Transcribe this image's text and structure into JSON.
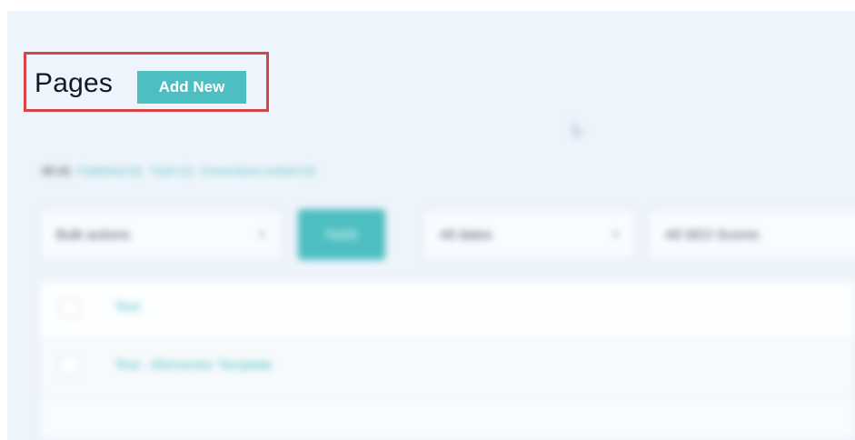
{
  "page": {
    "title": "Pages",
    "add_new_label": "Add New"
  },
  "filters": {
    "bulk_actions": "Bulk actions",
    "apply_label": "Apply",
    "dates": "All dates",
    "seo_scores": "All SEO Scores"
  },
  "views": {
    "all": "All (4)",
    "published": "Published (4)",
    "trash": "Trash (2)",
    "cornerstone": "Cornerstone content (0)"
  },
  "rows": [
    {
      "title": "Test"
    },
    {
      "title": "Test - Elementor Template"
    }
  ]
}
